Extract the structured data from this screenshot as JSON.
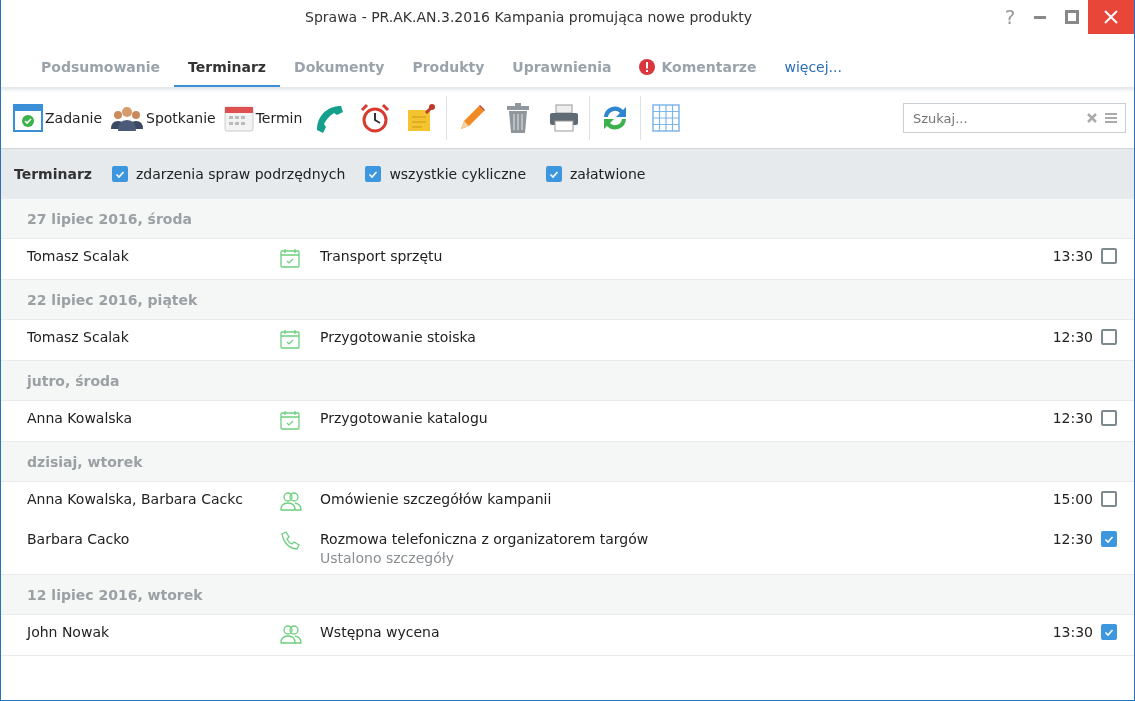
{
  "window": {
    "title": "Sprawa - PR.AK.AN.3.2016 Kampania promująca nowe produkty",
    "help": "?"
  },
  "tabs": [
    {
      "label": "Podsumowanie",
      "selected": false,
      "alert": false,
      "kind": "tab"
    },
    {
      "label": "Terminarz",
      "selected": true,
      "alert": false,
      "kind": "tab"
    },
    {
      "label": "Dokumenty",
      "selected": false,
      "alert": false,
      "kind": "tab"
    },
    {
      "label": "Produkty",
      "selected": false,
      "alert": false,
      "kind": "tab"
    },
    {
      "label": "Uprawnienia",
      "selected": false,
      "alert": false,
      "kind": "tab"
    },
    {
      "label": "Komentarze",
      "selected": false,
      "alert": true,
      "kind": "tab"
    },
    {
      "label": "więcej...",
      "selected": false,
      "alert": false,
      "kind": "more"
    }
  ],
  "toolbar": [
    {
      "kind": "task",
      "label": "Zadanie"
    },
    {
      "kind": "meeting",
      "label": "Spotkanie"
    },
    {
      "kind": "term",
      "label": "Termin"
    },
    {
      "kind": "phone"
    },
    {
      "kind": "alarm"
    },
    {
      "kind": "note"
    },
    {
      "kind": "separator"
    },
    {
      "kind": "pencil"
    },
    {
      "kind": "trash"
    },
    {
      "kind": "printer"
    },
    {
      "kind": "separator"
    },
    {
      "kind": "refresh"
    },
    {
      "kind": "separator"
    },
    {
      "kind": "grid"
    }
  ],
  "search": {
    "placeholder": "Szukaj..."
  },
  "filter": {
    "title": "Terminarz",
    "options": [
      {
        "label": "zdarzenia spraw podrzędnych",
        "checked": true
      },
      {
        "label": "wszystkie cykliczne",
        "checked": true
      },
      {
        "label": "załatwione",
        "checked": true
      }
    ]
  },
  "groups": [
    {
      "date": "27 lipiec 2016, środa",
      "entries": [
        {
          "kind": "task",
          "person": "Tomasz Scalak",
          "title": "Transport sprzętu",
          "time": "13:30",
          "done": false
        }
      ]
    },
    {
      "date": "22 lipiec 2016, piątek",
      "entries": [
        {
          "kind": "task",
          "person": "Tomasz Scalak",
          "title": "Przygotowanie stoiska",
          "time": "12:30",
          "done": false
        }
      ]
    },
    {
      "date": "jutro, środa",
      "entries": [
        {
          "kind": "task",
          "person": "Anna Kowalska",
          "title": "Przygotowanie katalogu",
          "time": "12:30",
          "done": false
        }
      ]
    },
    {
      "date": "dzisiaj, wtorek",
      "entries": [
        {
          "kind": "meeting",
          "person": "Anna Kowalska, Barbara Cackc",
          "title": "Omówienie szczegółów kampanii",
          "time": "15:00",
          "done": false
        },
        {
          "kind": "call",
          "person": "Barbara Cacko",
          "title": "Rozmowa telefoniczna z organizatorem targów",
          "note": "Ustalono szczegóły",
          "time": "12:30",
          "done": true
        }
      ]
    },
    {
      "date": "12 lipiec 2016, wtorek",
      "entries": [
        {
          "kind": "meeting",
          "person": "John Nowak",
          "title": "Wstępna wycena",
          "time": "13:30",
          "done": true
        }
      ]
    }
  ]
}
